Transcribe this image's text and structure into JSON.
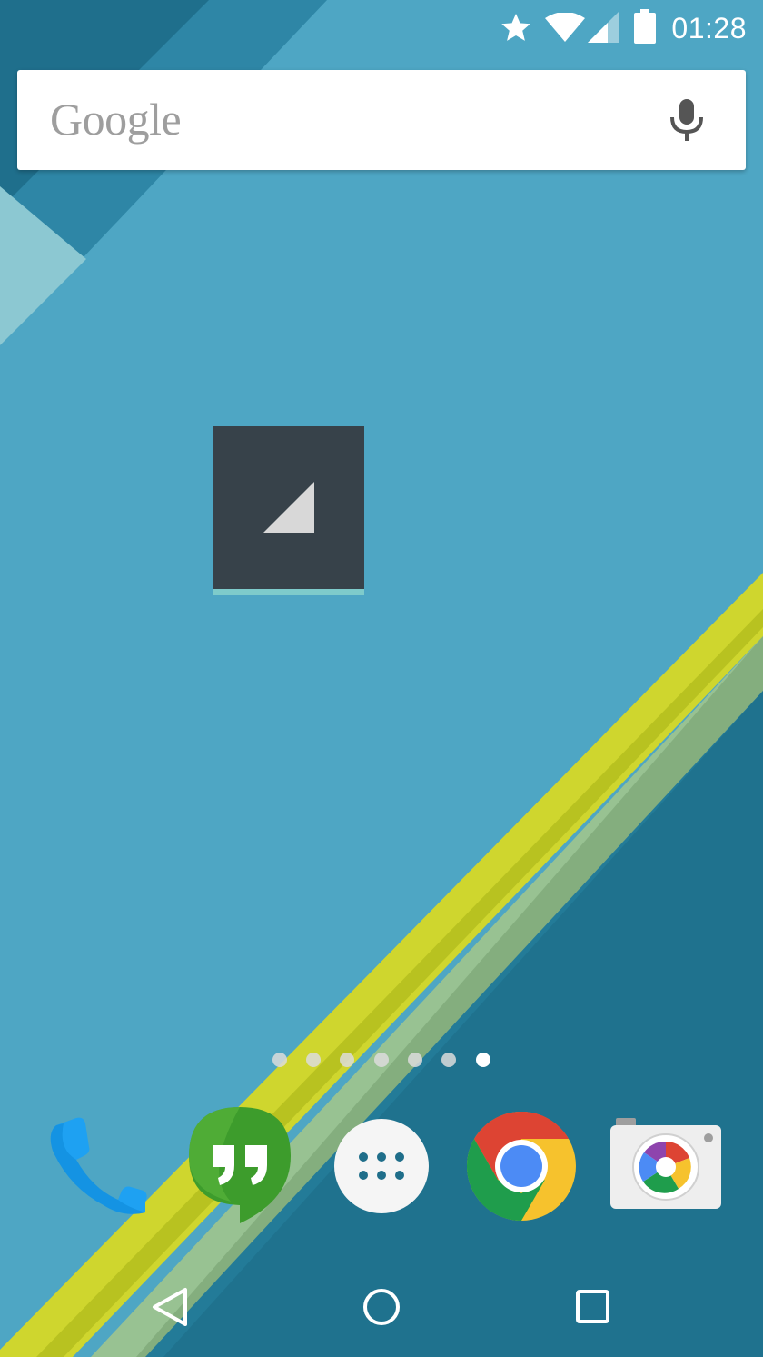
{
  "status_bar": {
    "time": "01:28",
    "icons": [
      "star-icon",
      "wifi-icon",
      "cell-signal-icon",
      "battery-icon"
    ]
  },
  "search": {
    "logo_text": "Google",
    "mic_icon": "microphone-icon"
  },
  "widget": {
    "icon": "cell-signal-icon",
    "accent_color": "#7ecbcb",
    "background_color": "#37424a"
  },
  "page_indicator": {
    "count": 7,
    "active_index": 6
  },
  "dock": {
    "apps": [
      {
        "name": "phone",
        "icon": "phone-icon"
      },
      {
        "name": "hangouts",
        "icon": "hangouts-icon"
      },
      {
        "name": "app-drawer",
        "icon": "app-drawer-icon"
      },
      {
        "name": "chrome",
        "icon": "chrome-icon"
      },
      {
        "name": "camera",
        "icon": "camera-icon"
      }
    ]
  },
  "nav_bar": {
    "buttons": [
      {
        "name": "back",
        "icon": "back-triangle-icon"
      },
      {
        "name": "home",
        "icon": "home-circle-icon"
      },
      {
        "name": "recents",
        "icon": "recents-square-icon"
      }
    ]
  },
  "colors": {
    "wallpaper_blue": "#4ea6c4",
    "wallpaper_dark": "#1f6f86",
    "wallpaper_yellow": "#c9d321"
  }
}
